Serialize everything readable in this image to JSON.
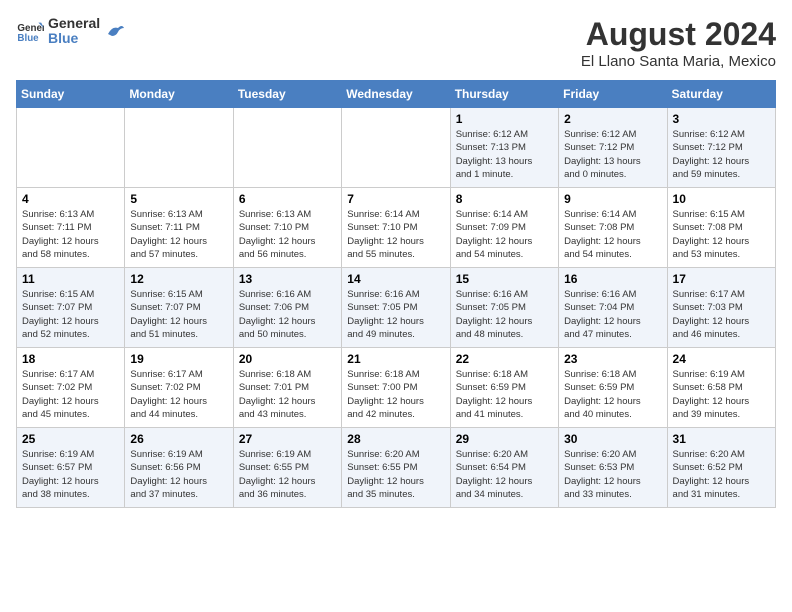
{
  "header": {
    "logo_line1": "General",
    "logo_line2": "Blue",
    "month_year": "August 2024",
    "location": "El Llano Santa Maria, Mexico"
  },
  "days_of_week": [
    "Sunday",
    "Monday",
    "Tuesday",
    "Wednesday",
    "Thursday",
    "Friday",
    "Saturday"
  ],
  "weeks": [
    [
      {
        "day": "",
        "info": ""
      },
      {
        "day": "",
        "info": ""
      },
      {
        "day": "",
        "info": ""
      },
      {
        "day": "",
        "info": ""
      },
      {
        "day": "1",
        "info": "Sunrise: 6:12 AM\nSunset: 7:13 PM\nDaylight: 13 hours\nand 1 minute."
      },
      {
        "day": "2",
        "info": "Sunrise: 6:12 AM\nSunset: 7:12 PM\nDaylight: 13 hours\nand 0 minutes."
      },
      {
        "day": "3",
        "info": "Sunrise: 6:12 AM\nSunset: 7:12 PM\nDaylight: 12 hours\nand 59 minutes."
      }
    ],
    [
      {
        "day": "4",
        "info": "Sunrise: 6:13 AM\nSunset: 7:11 PM\nDaylight: 12 hours\nand 58 minutes."
      },
      {
        "day": "5",
        "info": "Sunrise: 6:13 AM\nSunset: 7:11 PM\nDaylight: 12 hours\nand 57 minutes."
      },
      {
        "day": "6",
        "info": "Sunrise: 6:13 AM\nSunset: 7:10 PM\nDaylight: 12 hours\nand 56 minutes."
      },
      {
        "day": "7",
        "info": "Sunrise: 6:14 AM\nSunset: 7:10 PM\nDaylight: 12 hours\nand 55 minutes."
      },
      {
        "day": "8",
        "info": "Sunrise: 6:14 AM\nSunset: 7:09 PM\nDaylight: 12 hours\nand 54 minutes."
      },
      {
        "day": "9",
        "info": "Sunrise: 6:14 AM\nSunset: 7:08 PM\nDaylight: 12 hours\nand 54 minutes."
      },
      {
        "day": "10",
        "info": "Sunrise: 6:15 AM\nSunset: 7:08 PM\nDaylight: 12 hours\nand 53 minutes."
      }
    ],
    [
      {
        "day": "11",
        "info": "Sunrise: 6:15 AM\nSunset: 7:07 PM\nDaylight: 12 hours\nand 52 minutes."
      },
      {
        "day": "12",
        "info": "Sunrise: 6:15 AM\nSunset: 7:07 PM\nDaylight: 12 hours\nand 51 minutes."
      },
      {
        "day": "13",
        "info": "Sunrise: 6:16 AM\nSunset: 7:06 PM\nDaylight: 12 hours\nand 50 minutes."
      },
      {
        "day": "14",
        "info": "Sunrise: 6:16 AM\nSunset: 7:05 PM\nDaylight: 12 hours\nand 49 minutes."
      },
      {
        "day": "15",
        "info": "Sunrise: 6:16 AM\nSunset: 7:05 PM\nDaylight: 12 hours\nand 48 minutes."
      },
      {
        "day": "16",
        "info": "Sunrise: 6:16 AM\nSunset: 7:04 PM\nDaylight: 12 hours\nand 47 minutes."
      },
      {
        "day": "17",
        "info": "Sunrise: 6:17 AM\nSunset: 7:03 PM\nDaylight: 12 hours\nand 46 minutes."
      }
    ],
    [
      {
        "day": "18",
        "info": "Sunrise: 6:17 AM\nSunset: 7:02 PM\nDaylight: 12 hours\nand 45 minutes."
      },
      {
        "day": "19",
        "info": "Sunrise: 6:17 AM\nSunset: 7:02 PM\nDaylight: 12 hours\nand 44 minutes."
      },
      {
        "day": "20",
        "info": "Sunrise: 6:18 AM\nSunset: 7:01 PM\nDaylight: 12 hours\nand 43 minutes."
      },
      {
        "day": "21",
        "info": "Sunrise: 6:18 AM\nSunset: 7:00 PM\nDaylight: 12 hours\nand 42 minutes."
      },
      {
        "day": "22",
        "info": "Sunrise: 6:18 AM\nSunset: 6:59 PM\nDaylight: 12 hours\nand 41 minutes."
      },
      {
        "day": "23",
        "info": "Sunrise: 6:18 AM\nSunset: 6:59 PM\nDaylight: 12 hours\nand 40 minutes."
      },
      {
        "day": "24",
        "info": "Sunrise: 6:19 AM\nSunset: 6:58 PM\nDaylight: 12 hours\nand 39 minutes."
      }
    ],
    [
      {
        "day": "25",
        "info": "Sunrise: 6:19 AM\nSunset: 6:57 PM\nDaylight: 12 hours\nand 38 minutes."
      },
      {
        "day": "26",
        "info": "Sunrise: 6:19 AM\nSunset: 6:56 PM\nDaylight: 12 hours\nand 37 minutes."
      },
      {
        "day": "27",
        "info": "Sunrise: 6:19 AM\nSunset: 6:55 PM\nDaylight: 12 hours\nand 36 minutes."
      },
      {
        "day": "28",
        "info": "Sunrise: 6:20 AM\nSunset: 6:55 PM\nDaylight: 12 hours\nand 35 minutes."
      },
      {
        "day": "29",
        "info": "Sunrise: 6:20 AM\nSunset: 6:54 PM\nDaylight: 12 hours\nand 34 minutes."
      },
      {
        "day": "30",
        "info": "Sunrise: 6:20 AM\nSunset: 6:53 PM\nDaylight: 12 hours\nand 33 minutes."
      },
      {
        "day": "31",
        "info": "Sunrise: 6:20 AM\nSunset: 6:52 PM\nDaylight: 12 hours\nand 31 minutes."
      }
    ]
  ]
}
